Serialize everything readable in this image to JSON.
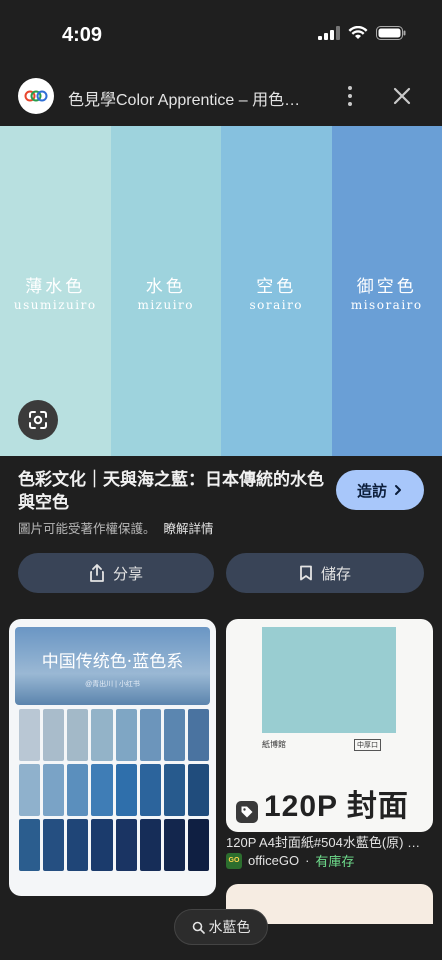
{
  "status": {
    "time": "4:09"
  },
  "header": {
    "site_title": "色見學Color Apprentice – 用色…"
  },
  "hero": {
    "swatches": [
      {
        "kanji": "薄水色",
        "romaji": "usumizuiro",
        "color": "#b8e0e0"
      },
      {
        "kanji": "水色",
        "romaji": "mizuiro",
        "color": "#9ed3dd"
      },
      {
        "kanji": "空色",
        "romaji": "sorairo",
        "color": "#86c1df"
      },
      {
        "kanji": "御空色",
        "romaji": "misorairo",
        "color": "#6a9fd6"
      }
    ]
  },
  "result": {
    "title": "色彩文化｜天與海之藍：日本傳統的水色與空色",
    "visit_label": "造訪",
    "copyright_note": "圖片可能受著作權保護。",
    "learn_more": "瞭解詳情",
    "share_label": "分享",
    "save_label": "儲存"
  },
  "related": {
    "left": {
      "banner_title": "中国传统色·蓝色系",
      "banner_sub": "@青出川 | 小红书",
      "palette": [
        "#b9c7d4",
        "#a9bccb",
        "#a3b9c8",
        "#93b3c8",
        "#7fa6c4",
        "#6c95bb",
        "#5b86b0",
        "#4a73a0",
        "#8fb1cc",
        "#7aa3c6",
        "#5b8fbd",
        "#3f7db6",
        "#2f6fab",
        "#2c649c",
        "#275a8d",
        "#204c7c",
        "#2b5d8e",
        "#254f81",
        "#1f4577",
        "#1b3b6c",
        "#1a3463",
        "#162d58",
        "#13264d",
        "#0f1f42"
      ]
    },
    "right": {
      "paper_label": "紙博館",
      "paper_tag": "中厚口",
      "paper_big": "120P 封面紙",
      "caption": "120P A4封面紙#504水藍色(原) …",
      "source": "officeGO",
      "source_logo": "GO",
      "stock": "有庫存"
    }
  },
  "search_chip": {
    "label": "水藍色"
  },
  "colors": {
    "accent": "#a8c7fa",
    "background": "#1f1f1f",
    "button": "#394457"
  }
}
